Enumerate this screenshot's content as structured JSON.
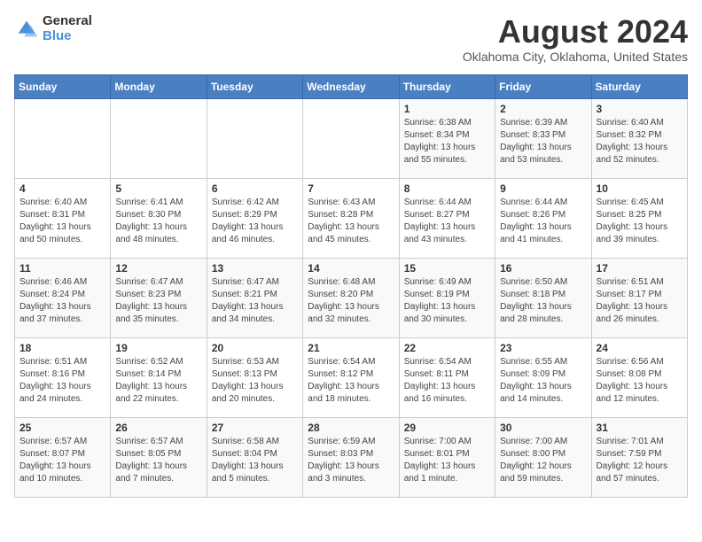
{
  "logo": {
    "general": "General",
    "blue": "Blue"
  },
  "header": {
    "month_year": "August 2024",
    "location": "Oklahoma City, Oklahoma, United States"
  },
  "days_of_week": [
    "Sunday",
    "Monday",
    "Tuesday",
    "Wednesday",
    "Thursday",
    "Friday",
    "Saturday"
  ],
  "weeks": [
    [
      {
        "day": "",
        "info": ""
      },
      {
        "day": "",
        "info": ""
      },
      {
        "day": "",
        "info": ""
      },
      {
        "day": "",
        "info": ""
      },
      {
        "day": "1",
        "info": "Sunrise: 6:38 AM\nSunset: 8:34 PM\nDaylight: 13 hours\nand 55 minutes."
      },
      {
        "day": "2",
        "info": "Sunrise: 6:39 AM\nSunset: 8:33 PM\nDaylight: 13 hours\nand 53 minutes."
      },
      {
        "day": "3",
        "info": "Sunrise: 6:40 AM\nSunset: 8:32 PM\nDaylight: 13 hours\nand 52 minutes."
      }
    ],
    [
      {
        "day": "4",
        "info": "Sunrise: 6:40 AM\nSunset: 8:31 PM\nDaylight: 13 hours\nand 50 minutes."
      },
      {
        "day": "5",
        "info": "Sunrise: 6:41 AM\nSunset: 8:30 PM\nDaylight: 13 hours\nand 48 minutes."
      },
      {
        "day": "6",
        "info": "Sunrise: 6:42 AM\nSunset: 8:29 PM\nDaylight: 13 hours\nand 46 minutes."
      },
      {
        "day": "7",
        "info": "Sunrise: 6:43 AM\nSunset: 8:28 PM\nDaylight: 13 hours\nand 45 minutes."
      },
      {
        "day": "8",
        "info": "Sunrise: 6:44 AM\nSunset: 8:27 PM\nDaylight: 13 hours\nand 43 minutes."
      },
      {
        "day": "9",
        "info": "Sunrise: 6:44 AM\nSunset: 8:26 PM\nDaylight: 13 hours\nand 41 minutes."
      },
      {
        "day": "10",
        "info": "Sunrise: 6:45 AM\nSunset: 8:25 PM\nDaylight: 13 hours\nand 39 minutes."
      }
    ],
    [
      {
        "day": "11",
        "info": "Sunrise: 6:46 AM\nSunset: 8:24 PM\nDaylight: 13 hours\nand 37 minutes."
      },
      {
        "day": "12",
        "info": "Sunrise: 6:47 AM\nSunset: 8:23 PM\nDaylight: 13 hours\nand 35 minutes."
      },
      {
        "day": "13",
        "info": "Sunrise: 6:47 AM\nSunset: 8:21 PM\nDaylight: 13 hours\nand 34 minutes."
      },
      {
        "day": "14",
        "info": "Sunrise: 6:48 AM\nSunset: 8:20 PM\nDaylight: 13 hours\nand 32 minutes."
      },
      {
        "day": "15",
        "info": "Sunrise: 6:49 AM\nSunset: 8:19 PM\nDaylight: 13 hours\nand 30 minutes."
      },
      {
        "day": "16",
        "info": "Sunrise: 6:50 AM\nSunset: 8:18 PM\nDaylight: 13 hours\nand 28 minutes."
      },
      {
        "day": "17",
        "info": "Sunrise: 6:51 AM\nSunset: 8:17 PM\nDaylight: 13 hours\nand 26 minutes."
      }
    ],
    [
      {
        "day": "18",
        "info": "Sunrise: 6:51 AM\nSunset: 8:16 PM\nDaylight: 13 hours\nand 24 minutes."
      },
      {
        "day": "19",
        "info": "Sunrise: 6:52 AM\nSunset: 8:14 PM\nDaylight: 13 hours\nand 22 minutes."
      },
      {
        "day": "20",
        "info": "Sunrise: 6:53 AM\nSunset: 8:13 PM\nDaylight: 13 hours\nand 20 minutes."
      },
      {
        "day": "21",
        "info": "Sunrise: 6:54 AM\nSunset: 8:12 PM\nDaylight: 13 hours\nand 18 minutes."
      },
      {
        "day": "22",
        "info": "Sunrise: 6:54 AM\nSunset: 8:11 PM\nDaylight: 13 hours\nand 16 minutes."
      },
      {
        "day": "23",
        "info": "Sunrise: 6:55 AM\nSunset: 8:09 PM\nDaylight: 13 hours\nand 14 minutes."
      },
      {
        "day": "24",
        "info": "Sunrise: 6:56 AM\nSunset: 8:08 PM\nDaylight: 13 hours\nand 12 minutes."
      }
    ],
    [
      {
        "day": "25",
        "info": "Sunrise: 6:57 AM\nSunset: 8:07 PM\nDaylight: 13 hours\nand 10 minutes."
      },
      {
        "day": "26",
        "info": "Sunrise: 6:57 AM\nSunset: 8:05 PM\nDaylight: 13 hours\nand 7 minutes."
      },
      {
        "day": "27",
        "info": "Sunrise: 6:58 AM\nSunset: 8:04 PM\nDaylight: 13 hours\nand 5 minutes."
      },
      {
        "day": "28",
        "info": "Sunrise: 6:59 AM\nSunset: 8:03 PM\nDaylight: 13 hours\nand 3 minutes."
      },
      {
        "day": "29",
        "info": "Sunrise: 7:00 AM\nSunset: 8:01 PM\nDaylight: 13 hours\nand 1 minute."
      },
      {
        "day": "30",
        "info": "Sunrise: 7:00 AM\nSunset: 8:00 PM\nDaylight: 12 hours\nand 59 minutes."
      },
      {
        "day": "31",
        "info": "Sunrise: 7:01 AM\nSunset: 7:59 PM\nDaylight: 12 hours\nand 57 minutes."
      }
    ]
  ]
}
